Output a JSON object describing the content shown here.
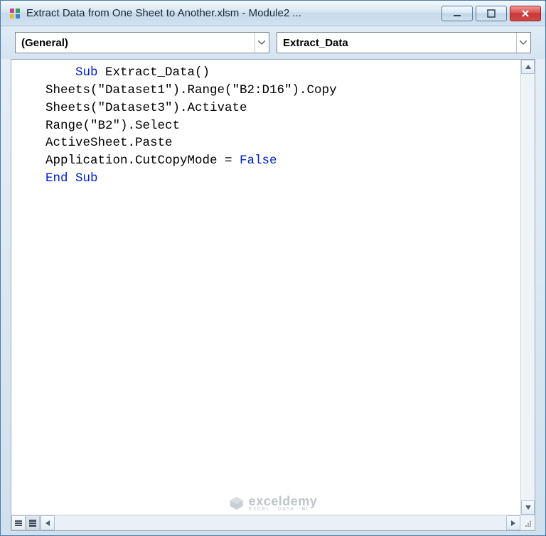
{
  "titlebar": {
    "title": "Extract Data from One Sheet to Another.xlsm - Module2 ..."
  },
  "dropdowns": {
    "left": "(General)",
    "right": "Extract_Data"
  },
  "code": {
    "lines": [
      {
        "segments": [
          {
            "t": "Sub ",
            "c": "kw"
          },
          {
            "t": "Extract_Data()",
            "c": ""
          }
        ]
      },
      {
        "segments": [
          {
            "t": "Sheets(\"Dataset1\").Range(\"B2:D16\").Copy",
            "c": ""
          }
        ],
        "outdent": true
      },
      {
        "segments": [
          {
            "t": "Sheets(\"Dataset3\").Activate",
            "c": ""
          }
        ],
        "outdent": true
      },
      {
        "segments": [
          {
            "t": "Range(\"B2\").Select",
            "c": ""
          }
        ],
        "outdent": true
      },
      {
        "segments": [
          {
            "t": "ActiveSheet.Paste",
            "c": ""
          }
        ],
        "outdent": true
      },
      {
        "segments": [
          {
            "t": "Application.CutCopyMode = ",
            "c": ""
          },
          {
            "t": "False",
            "c": "kw"
          }
        ],
        "outdent": true
      },
      {
        "segments": [
          {
            "t": "End Sub",
            "c": "kw"
          }
        ],
        "outdent": true
      }
    ]
  },
  "watermark": {
    "main": "exceldemy",
    "sub": "EXCEL · DATA · BI"
  }
}
